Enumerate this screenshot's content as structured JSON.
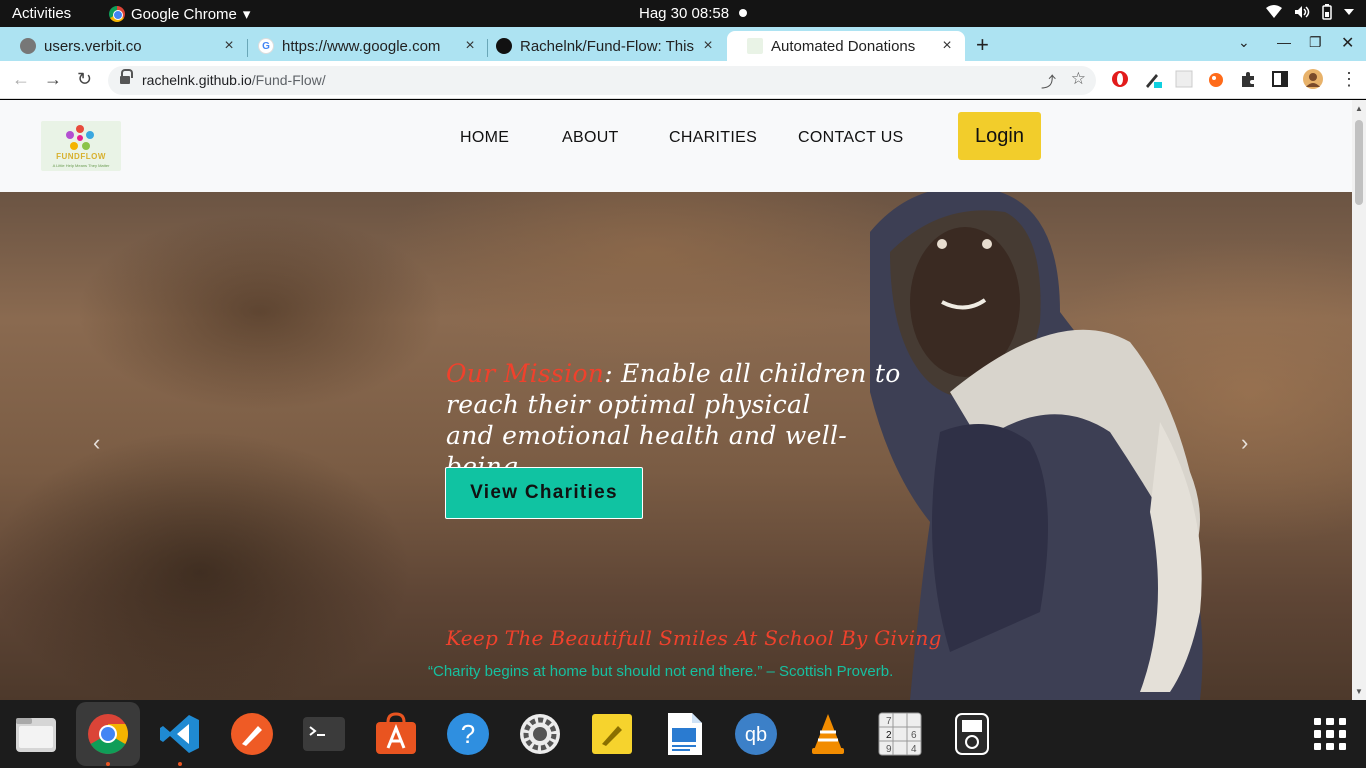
{
  "system_bar": {
    "activities": "Activities",
    "app_name": "Google Chrome",
    "app_menu_arrow": "▾",
    "clock": "Hag 30  08:58"
  },
  "tabs": [
    {
      "title": "users.verbit.co",
      "close": "×"
    },
    {
      "title": "https://www.google.com",
      "close": "×"
    },
    {
      "title": "Rachelnk/Fund-Flow: This",
      "close": "×"
    },
    {
      "title": "Automated Donations",
      "close": "×"
    }
  ],
  "address_bar": {
    "host": "rachelnk.github.io",
    "path": "/Fund-Flow/"
  },
  "site": {
    "logo_word": "FUNDFLOW",
    "logo_tagline": "A Little Help Means They Matter",
    "nav": [
      "HOME",
      "ABOUT",
      "CHARITIES",
      "CONTACT US"
    ],
    "login": "Login"
  },
  "hero": {
    "mission_label": "Our Mission",
    "mission_line1": ": Enable all children to",
    "mission_line2": "reach their optimal physical",
    "mission_line3": "and emotional health and well-being.",
    "cta": "View Charities",
    "prev": "‹",
    "next": "›",
    "tagline": "Keep The Beautifull Smiles At School By Giving",
    "proverb": "“Charity begins at home but should not end there.” – Scottish Proverb."
  },
  "colors": {
    "accent_red": "#f0412c",
    "accent_teal": "#10c3a2",
    "login_yellow": "#f2cd2b",
    "tab_strip": "#ade3f2"
  },
  "dock_apps": [
    "files-icon",
    "chrome-icon",
    "vscode-icon",
    "postman-icon",
    "terminal-icon",
    "software-center-icon",
    "help-icon",
    "settings-icon",
    "text-editor-icon",
    "document-viewer-icon",
    "qbittorrent-icon",
    "vlc-icon",
    "sudoku-icon",
    "media-player-icon",
    "app-grid-icon"
  ]
}
